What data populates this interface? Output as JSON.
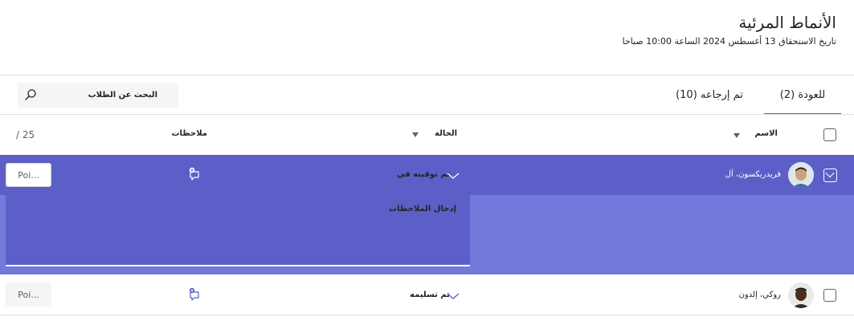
{
  "header": {
    "title": "الأنماط المرئية",
    "due_date": "تاريخ الاستحقاق 13 أغسطس 2024 الساعة 10:00 صباحا"
  },
  "tabs": [
    {
      "label": "للعودة (2)",
      "active": true
    },
    {
      "label": "تم إرجاعه (10)",
      "active": false
    }
  ],
  "search": {
    "label": "البحث عن الطلاب"
  },
  "columns": {
    "name": "الاسم",
    "status": "الحالة",
    "feedback": "ملاحظات",
    "points": "/ 25"
  },
  "students": [
    {
      "name": "فريدريكسون، آل",
      "status": "تم توقيته في",
      "points_placeholder": "Poi...",
      "selected": true,
      "expanded": true,
      "feedback_placeholder": "إدخال الملاحظات"
    },
    {
      "name": "روكي، إلدون",
      "status": "تم تسليمه",
      "points_placeholder": "Poi...",
      "selected": false,
      "expanded": false
    }
  ],
  "colors": {
    "accent": "#5b5fc7",
    "accent_light": "#7479dc",
    "divider": "#e1e1e1"
  },
  "icons": {
    "search": "search-icon",
    "chevron": "chevron-down-icon",
    "feedback": "add-feedback-icon",
    "sort": "sort-caret-icon"
  }
}
